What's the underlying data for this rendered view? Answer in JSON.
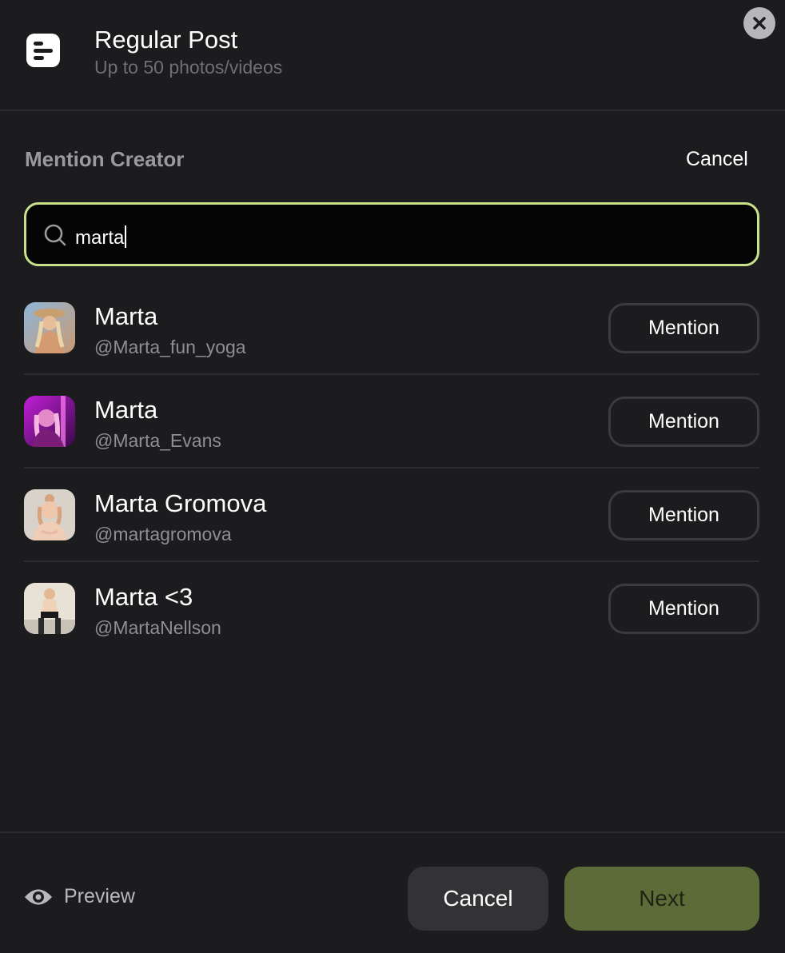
{
  "header": {
    "title": "Regular Post",
    "subtitle": "Up to 50 photos/videos"
  },
  "mention": {
    "title": "Mention Creator",
    "cancel_label": "Cancel",
    "search_value": "marta"
  },
  "results": [
    {
      "name": "Marta",
      "handle": "@Marta_fun_yoga",
      "button_label": "Mention"
    },
    {
      "name": "Marta",
      "handle": "@Marta_Evans",
      "button_label": "Mention"
    },
    {
      "name": "Marta Gromova",
      "handle": "@martagromova",
      "button_label": "Mention"
    },
    {
      "name": "Marta <3",
      "handle": "@MartaNellson",
      "button_label": "Mention"
    }
  ],
  "footer": {
    "preview_label": "Preview",
    "cancel_label": "Cancel",
    "next_label": "Next"
  },
  "colors": {
    "accent_border": "#c9e08a",
    "next_button_bg": "#5d6b39",
    "background": "#1c1c1e"
  },
  "icons": {
    "post": "post-type-icon",
    "close": "close-icon",
    "search": "search-icon",
    "preview": "eye-icon"
  }
}
